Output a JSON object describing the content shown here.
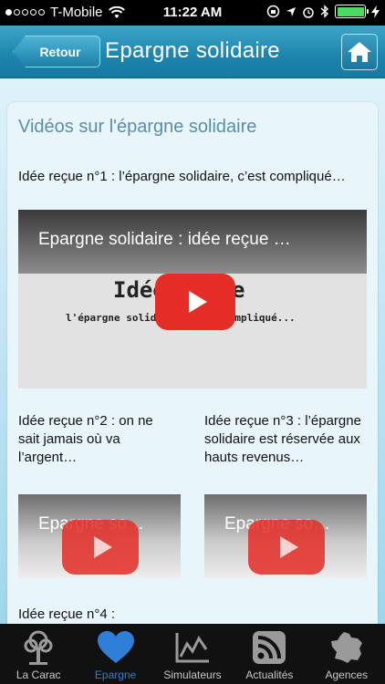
{
  "status": {
    "carrier": "T-Mobile",
    "time": "11:22 AM"
  },
  "nav": {
    "back_label": "Retour",
    "title": "Epargne solidaire"
  },
  "content": {
    "section_title": "Vidéos sur l'épargne solidaire",
    "videos": [
      {
        "caption": "Idée reçue n°1 : l’épargne solidaire, c’est compliqué…",
        "title": "Epargne solidaire : idée reçue …",
        "frame_line1": "Idée reçue n°1 :",
        "frame_line2": "l'épargne solidaire c'est compliqué..."
      },
      {
        "caption": "Idée reçue n°2 : on ne sait jamais où va l’argent…",
        "title": "Epargne so…"
      },
      {
        "caption": "Idée reçue n°3 : l’épargne solidaire est réservée aux hauts revenus…",
        "title": "Epargne so…"
      },
      {
        "caption": "Idée reçue n°4 :"
      }
    ]
  },
  "tabs": [
    {
      "label": "La Carac",
      "icon": "tree-icon",
      "active": false
    },
    {
      "label": "Epargne",
      "icon": "heart-icon",
      "active": true
    },
    {
      "label": "Simulateurs",
      "icon": "chart-icon",
      "active": false
    },
    {
      "label": "Actualités",
      "icon": "rss-icon",
      "active": false
    },
    {
      "label": "Agences",
      "icon": "france-map-icon",
      "active": false
    }
  ],
  "colors": {
    "nav_bar": "#1f86ae",
    "active_tab": "#2f7fd8",
    "play_button": "#e52d27",
    "section_title": "#5a8ea8"
  }
}
